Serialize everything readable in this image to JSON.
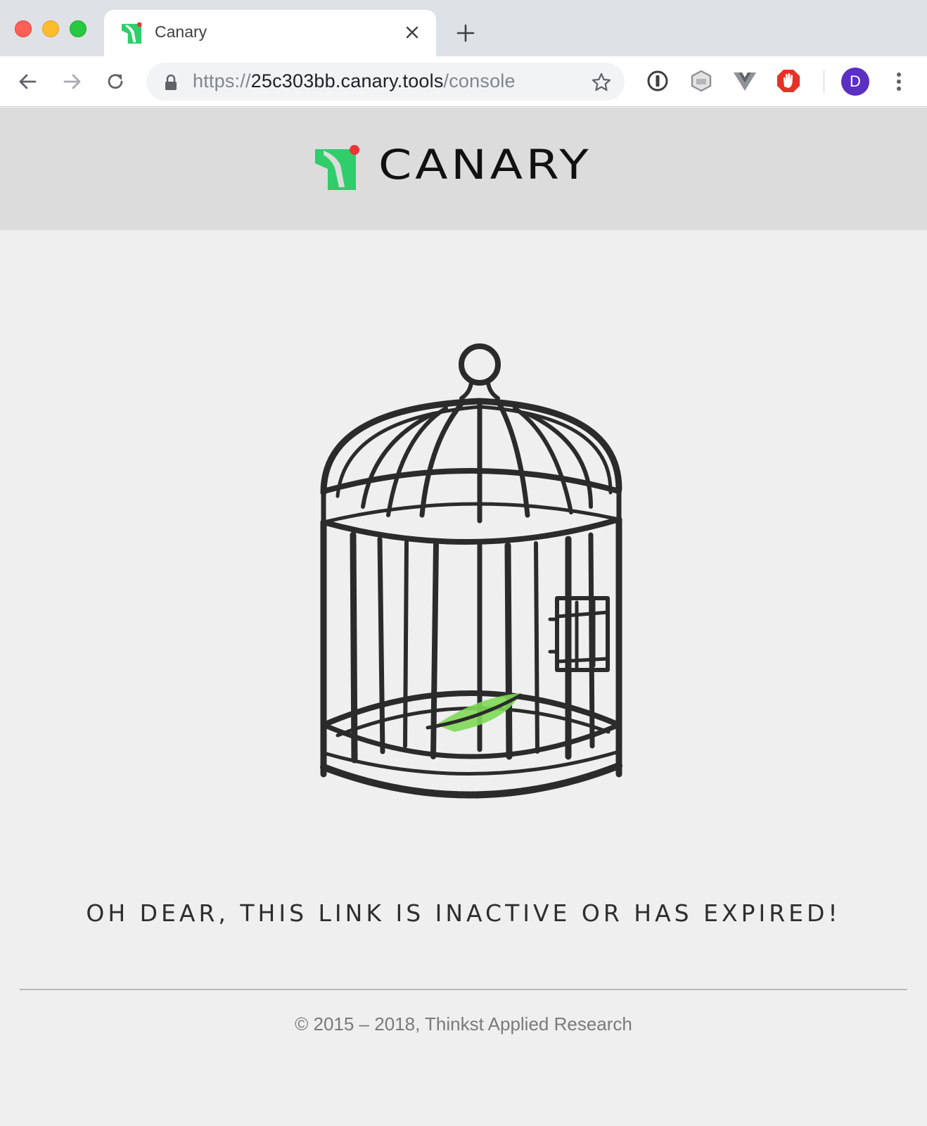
{
  "browser": {
    "tab": {
      "title": "Canary"
    },
    "address_bar": {
      "scheme": "https://",
      "host": "25c303bb.canary.tools",
      "path": "/console"
    },
    "profile_initial": "D",
    "extension_icons": [
      "1password-icon",
      "extension-icon",
      "vue-devtools-icon",
      "adblock-icon"
    ]
  },
  "page": {
    "logo_text": "CANARY",
    "message": "OH DEAR, THIS LINK IS INACTIVE OR HAS EXPIRED!",
    "footer": "© 2015 – 2018, Thinkst Applied Research"
  },
  "colors": {
    "brand_green": "#2fce6b",
    "brand_red": "#ee3535",
    "avatar": "#5a2fc2"
  }
}
